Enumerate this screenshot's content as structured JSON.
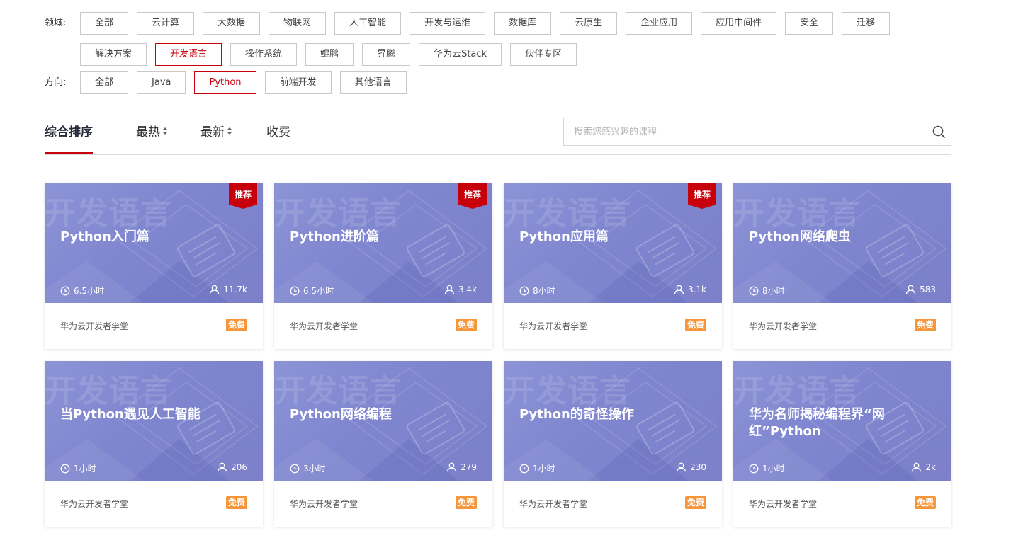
{
  "filters": {
    "domain": {
      "label": "领域:",
      "options": [
        "全部",
        "云计算",
        "大数据",
        "物联网",
        "人工智能",
        "开发与运维",
        "数据库",
        "云原生",
        "企业应用",
        "应用中间件",
        "安全",
        "迁移",
        "解决方案",
        "开发语言",
        "操作系统",
        "鲲鹏",
        "昇腾",
        "华为云Stack",
        "伙伴专区"
      ],
      "selected": "开发语言"
    },
    "direction": {
      "label": "方向:",
      "options": [
        "全部",
        "Java",
        "Python",
        "前端开发",
        "其他语言"
      ],
      "selected": "Python"
    }
  },
  "tabs": [
    {
      "label": "综合排序",
      "active": true,
      "sortable": false
    },
    {
      "label": "最热",
      "active": false,
      "sortable": true
    },
    {
      "label": "最新",
      "active": false,
      "sortable": true
    },
    {
      "label": "收费",
      "active": false,
      "sortable": false
    }
  ],
  "search": {
    "placeholder": "搜索您感兴趣的课程",
    "value": "",
    "icon": "search-icon"
  },
  "cover_watermark": "开发语言",
  "badge_label": "推荐",
  "colors": {
    "accent": "#c7000b",
    "cover": "#7f86cf",
    "price_tag": "#f7953a"
  },
  "courses": [
    {
      "title": "Python入门篇",
      "duration": "6.5小时",
      "learners": "11.7k",
      "recommended": true,
      "provider": "华为云开发者学堂",
      "price": "免费"
    },
    {
      "title": "Python进阶篇",
      "duration": "6.5小时",
      "learners": "3.4k",
      "recommended": true,
      "provider": "华为云开发者学堂",
      "price": "免费"
    },
    {
      "title": "Python应用篇",
      "duration": "8小时",
      "learners": "3.1k",
      "recommended": true,
      "provider": "华为云开发者学堂",
      "price": "免费"
    },
    {
      "title": "Python网络爬虫",
      "duration": "8小时",
      "learners": "583",
      "recommended": false,
      "provider": "华为云开发者学堂",
      "price": "免费"
    },
    {
      "title": "当Python遇见人工智能",
      "duration": "1小时",
      "learners": "206",
      "recommended": false,
      "provider": "华为云开发者学堂",
      "price": "免费"
    },
    {
      "title": "Python网络编程",
      "duration": "3小时",
      "learners": "279",
      "recommended": false,
      "provider": "华为云开发者学堂",
      "price": "免费"
    },
    {
      "title": "Python的奇怪操作",
      "duration": "1小时",
      "learners": "230",
      "recommended": false,
      "provider": "华为云开发者学堂",
      "price": "免费"
    },
    {
      "title": "华为名师揭秘编程界“网红”Python",
      "duration": "1小时",
      "learners": "2k",
      "recommended": false,
      "provider": "华为云开发者学堂",
      "price": "免费"
    }
  ]
}
